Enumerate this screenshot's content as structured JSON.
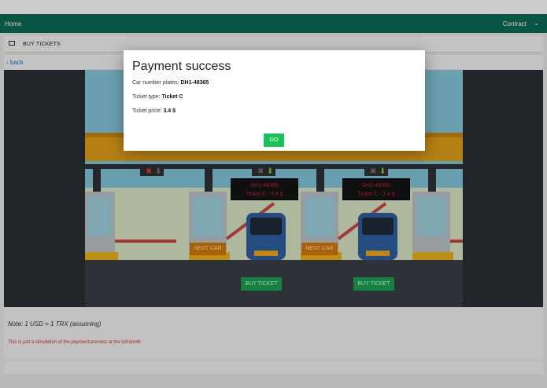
{
  "topbar": {
    "home": "Home",
    "contract": "Contract"
  },
  "breadcrumb": {
    "label": "BUY TICKETS"
  },
  "nav": {
    "back": "‹ back"
  },
  "booths": [
    {
      "screen_plate": "DH1-48365",
      "screen_ticket": "Ticket C - 3.4 $",
      "next_car": "NEXT CAR",
      "buy_ticket": "BUY TICKET"
    },
    {
      "screen_plate": "DH1-48365",
      "screen_ticket": "Ticket C - 3.4 $",
      "next_car": "NEXT CAR",
      "buy_ticket": "BUY TICKET"
    }
  ],
  "notes": {
    "rate": "Note: 1 USD = 1 TRX (assuming)",
    "simulation": "This is just a simulation of the payment process at the toll booth"
  },
  "modal": {
    "title": "Payment success",
    "plate_label": "Car number plates:",
    "plate_value": "DH1-48365",
    "type_label": "Ticket type:",
    "type_value": "Ticket C",
    "price_label": "Ticket price:",
    "price_value": "3.4 $",
    "go": "GO"
  },
  "colors": {
    "header": "#0b6b55",
    "go_button": "#19c25a",
    "buy_button": "#1aa351",
    "next_car": "#d47a0c",
    "led_text": "#d42020"
  }
}
